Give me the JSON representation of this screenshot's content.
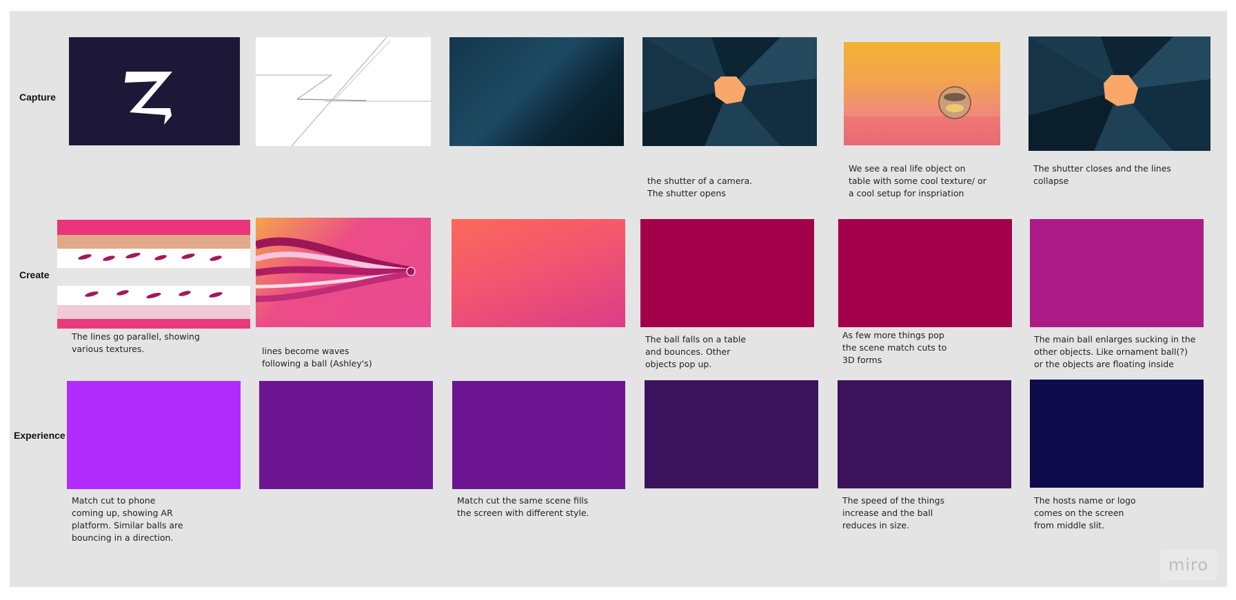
{
  "rows": {
    "capture": "Capture",
    "create": "Create",
    "experience": "Experience"
  },
  "notes": {
    "c4": "the shutter of a camera.\nThe shutter opens",
    "c5": "We see a real life object on\ntable with some cool texture/ or\na cool setup for inspriation",
    "c6": "The shutter closes and the lines\ncollapse",
    "r1": "The lines go parallel, showing\nvarious textures.",
    "r2": "lines                become waves\nfollowing a ball (Ashley's)",
    "r4": "The ball falls on a table\nand bounces. Other\nobjects pop up.",
    "r5": "As few more things pop\nthe scene match cuts to\n3D forms",
    "r6": "The main ball enlarges sucking in the\nother objects. Like ornament ball(?)\nor the objects are floating inside",
    "e1": "Match cut to phone\ncoming up, showing AR\nplatform. Similar balls are\nbouncing in a direction.",
    "e3": "Match cut the same scene fills\nthe screen with different style.",
    "e5": "The speed of the things\nincrease and the ball\nreduces in size.",
    "e6": "The hosts name or logo\ncomes on the screen\nfrom middle slit."
  },
  "brand": "miro",
  "colors": {
    "board": "#e4e4e4",
    "create_magenta": "#a3004a",
    "create_purple": "#ac1c86",
    "exp_violet": "#b12cfc",
    "exp_purple": "#6b1690",
    "exp_dark_purple": "#3b125c",
    "exp_navy": "#0e0a4c"
  }
}
